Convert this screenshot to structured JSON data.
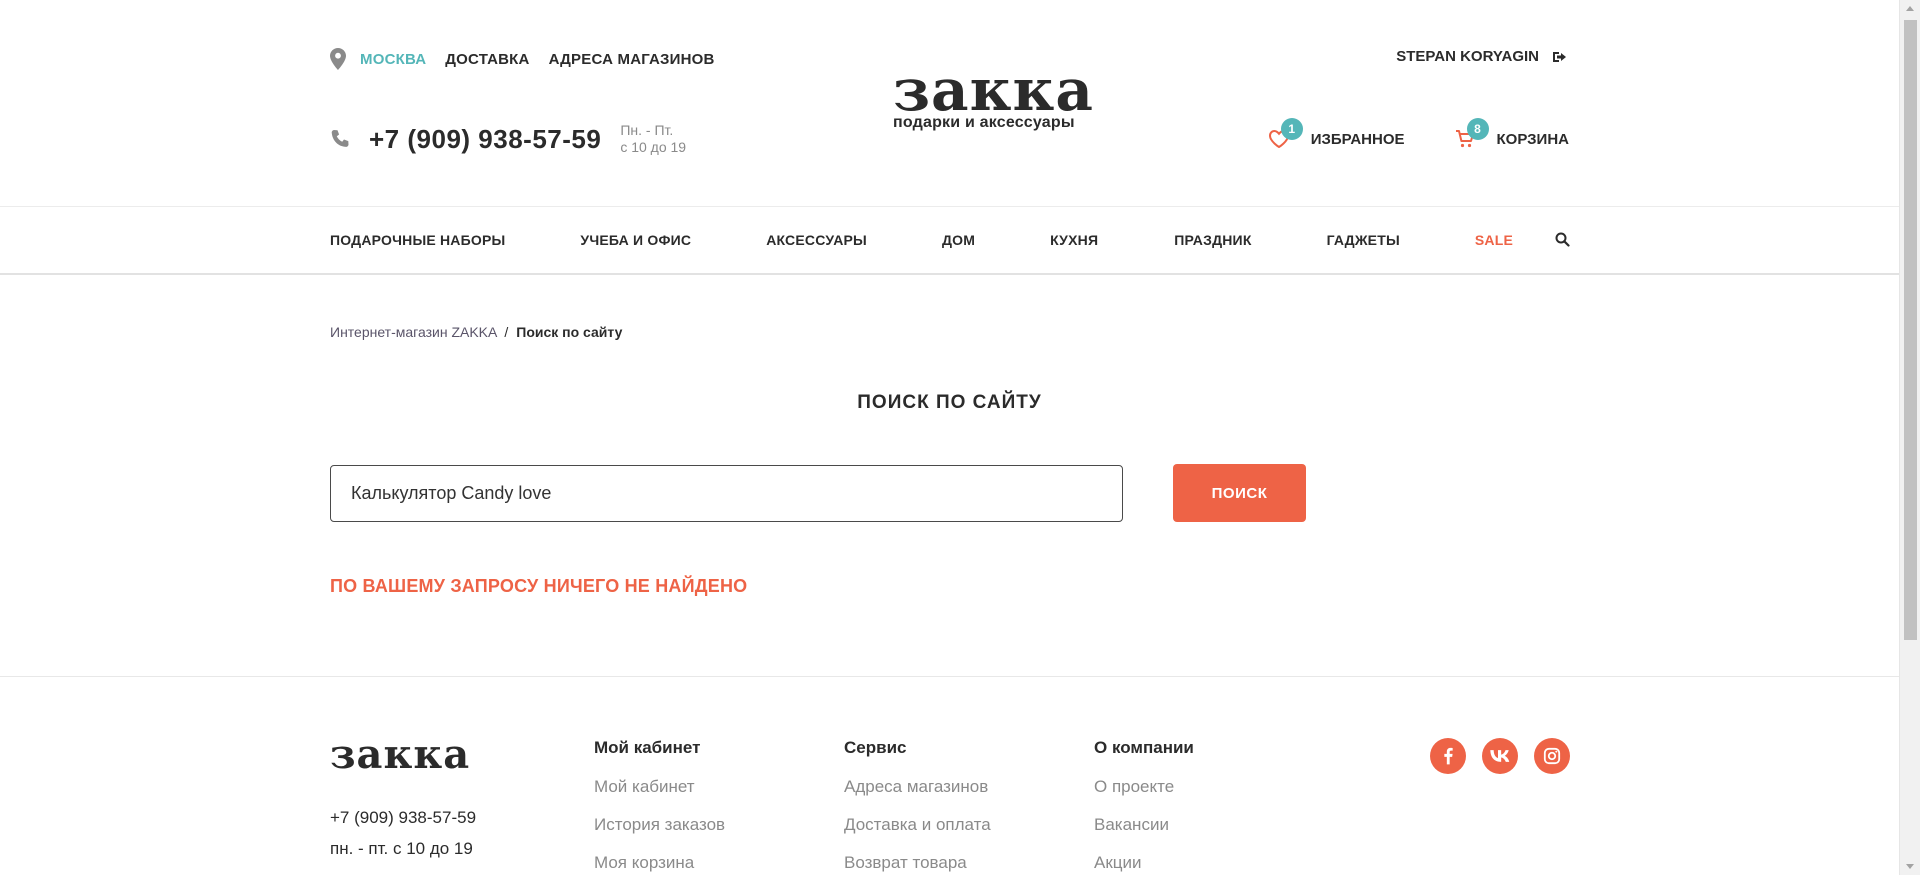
{
  "header": {
    "city": "МОСКВА",
    "links": [
      "ДОСТАВКА",
      "АДРЕСА МАГАЗИНОВ"
    ],
    "phone": "+7 (909) 938-57-59",
    "hours_line1": "Пн. - Пт.",
    "hours_line2": "с 10 до 19",
    "logo_main": "закка",
    "logo_sub": "подарки и аксессуары",
    "user_name": "STEPAN KORYAGIN",
    "favorites_label": "ИЗБРАННОЕ",
    "favorites_count": "1",
    "cart_label": "КОРЗИНА",
    "cart_count": "8"
  },
  "nav": {
    "items": [
      "ПОДАРОЧНЫЕ НАБОРЫ",
      "УЧЕБА И ОФИС",
      "АКСЕССУАРЫ",
      "ДОМ",
      "КУХНЯ",
      "ПРАЗДНИК",
      "ГАДЖЕТЫ",
      "SALE"
    ]
  },
  "breadcrumb": {
    "home": "Интернет-магазин ZAKKA",
    "separator": "/",
    "current": "Поиск по сайту"
  },
  "main": {
    "title": "ПОИСК ПО САЙТУ",
    "search_value": "Калькулятор Candy love",
    "search_button": "ПОИСК",
    "not_found": "ПО ВАШЕМУ ЗАПРОСУ НИЧЕГО НЕ НАЙДЕНО"
  },
  "footer": {
    "logo": "закка",
    "phone": "+7 (909) 938-57-59",
    "hours": "пн. - пт. с 10 до 19",
    "columns": [
      {
        "head": "Мой кабинет",
        "links": [
          "Мой кабинет",
          "История заказов",
          "Моя корзина"
        ]
      },
      {
        "head": "Сервис",
        "links": [
          "Адреса магазинов",
          "Доставка и оплата",
          "Возврат товара"
        ]
      },
      {
        "head": "О компании",
        "links": [
          "О проекте",
          "Вакансии",
          "Акции"
        ]
      }
    ],
    "social": [
      "facebook-icon",
      "vk-icon",
      "instagram-icon"
    ]
  },
  "colors": {
    "accent": "#ee6346",
    "teal": "#54b6b8",
    "text": "#2b2b2b"
  }
}
